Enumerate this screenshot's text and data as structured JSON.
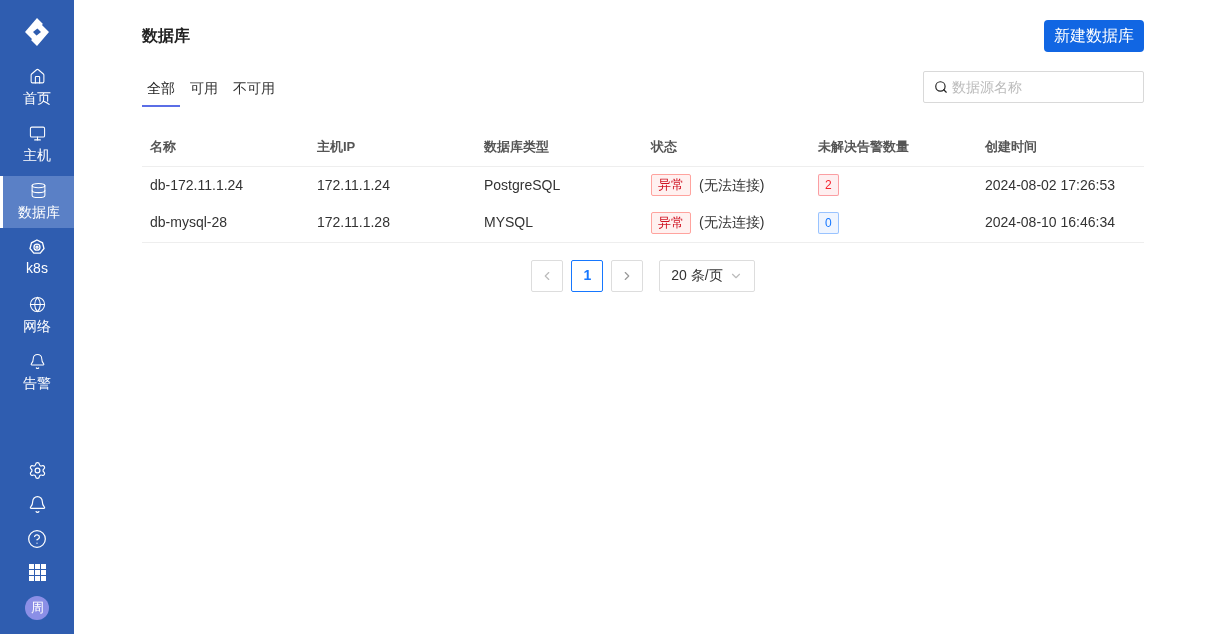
{
  "sidebar": {
    "items": [
      {
        "kind": "home",
        "label": "首页",
        "selected": false
      },
      {
        "kind": "host",
        "label": "主机",
        "selected": false
      },
      {
        "kind": "database",
        "label": "数据库",
        "selected": true
      },
      {
        "kind": "k8s",
        "label": "k8s",
        "selected": false
      },
      {
        "kind": "network",
        "label": "网络",
        "selected": false
      },
      {
        "kind": "alert",
        "label": "告警",
        "selected": false
      }
    ],
    "avatar": "周"
  },
  "page": {
    "title": "数据库",
    "new_button": "新建数据库"
  },
  "tabs": [
    {
      "label": "全部",
      "selected": true
    },
    {
      "label": "可用",
      "selected": false
    },
    {
      "label": "不可用",
      "selected": false
    }
  ],
  "search": {
    "placeholder": "数据源名称"
  },
  "table": {
    "columns": [
      "名称",
      "主机IP",
      "数据库类型",
      "状态",
      "未解决告警数量",
      "创建时间"
    ],
    "rows": [
      {
        "name": "db-172.11.1.24",
        "ip": "172.11.1.24",
        "type": "PostgreSQL",
        "status": "异常",
        "status_note": "(无法连接)",
        "alerts": {
          "count": "2",
          "color": "#f5222d"
        },
        "created": "2024-08-02 17:26:53"
      },
      {
        "name": "db-mysql-28",
        "ip": "172.11.1.28",
        "type": "MYSQL",
        "status": "异常",
        "status_note": "(无法连接)",
        "alerts": {
          "count": "0",
          "color": "#1677ff"
        },
        "created": "2024-08-10 16:46:34"
      }
    ]
  },
  "pagination": {
    "pages": [
      {
        "label": "1",
        "selected": true
      }
    ],
    "page_size": "20 条/页"
  }
}
